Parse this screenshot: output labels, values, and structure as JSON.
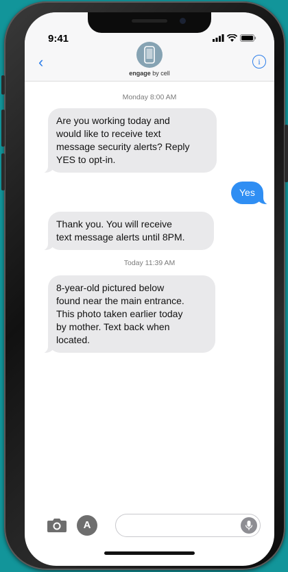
{
  "status_bar": {
    "time": "9:41"
  },
  "header": {
    "contact_bold": "engage",
    "contact_rest": " by cell"
  },
  "messages": [
    {
      "type": "timestamp",
      "text": "Monday 8:00 AM"
    },
    {
      "type": "incoming",
      "lines": [
        "Are you working today and",
        "would like to receive text",
        "message security alerts? Reply",
        "YES to opt-in."
      ]
    },
    {
      "type": "outgoing",
      "text": "Yes"
    },
    {
      "type": "incoming",
      "lines": [
        "Thank you. You will receive",
        "text message alerts until 8PM."
      ]
    },
    {
      "type": "timestamp",
      "text": "Today 11:39 AM"
    },
    {
      "type": "incoming",
      "lines": [
        "8-year-old pictured below",
        "found near the main entrance.",
        "This photo taken earlier today",
        "by mother. Text back when",
        "located."
      ]
    }
  ],
  "colors": {
    "background": "#12959a",
    "accent": "#2b7de9",
    "outgoing_bubble": "#2f8ef3",
    "incoming_bubble": "#e9e9eb"
  },
  "icons": [
    "back-chevron-icon",
    "contact-avatar-icon",
    "info-icon",
    "camera-icon",
    "app-store-icon",
    "microphone-icon",
    "signal-icon",
    "wifi-icon",
    "battery-icon"
  ]
}
